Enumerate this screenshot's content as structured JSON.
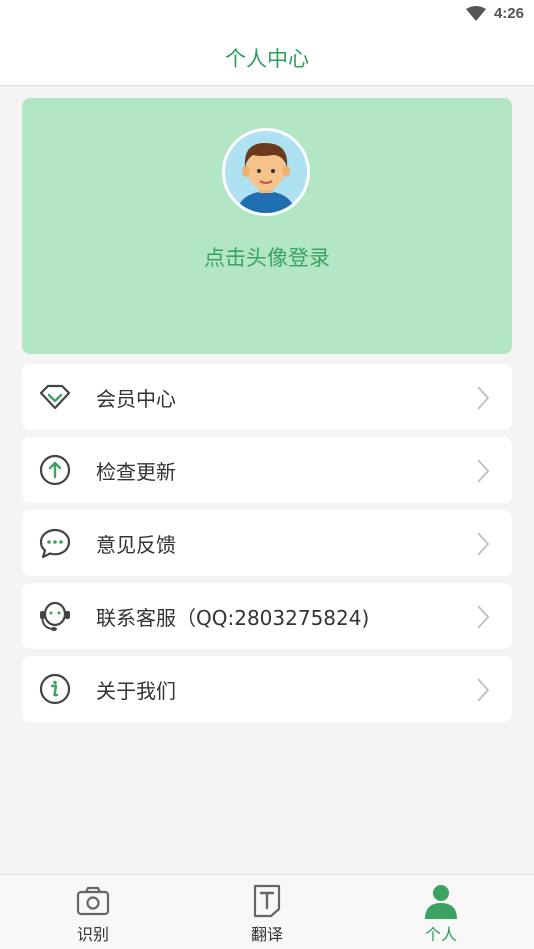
{
  "status_bar": {
    "time": "4:26"
  },
  "header": {
    "title": "个人中心"
  },
  "login": {
    "label": "点击头像登录"
  },
  "menu": [
    {
      "label": "会员中心",
      "icon": "diamond-icon"
    },
    {
      "label": "检查更新",
      "icon": "upload-arrow-icon"
    },
    {
      "label": "意见反馈",
      "icon": "chat-bubble-icon"
    },
    {
      "label": "联系客服（QQ:2803275824)",
      "icon": "headset-icon"
    },
    {
      "label": "关于我们",
      "icon": "info-icon"
    }
  ],
  "tabs": [
    {
      "label": "识别",
      "icon": "camera-icon"
    },
    {
      "label": "翻译",
      "icon": "text-document-icon"
    },
    {
      "label": "个人",
      "icon": "person-icon",
      "active": true
    }
  ],
  "colors": {
    "accent": "#2e9e5b",
    "card_bg": "#b3e6c4"
  }
}
